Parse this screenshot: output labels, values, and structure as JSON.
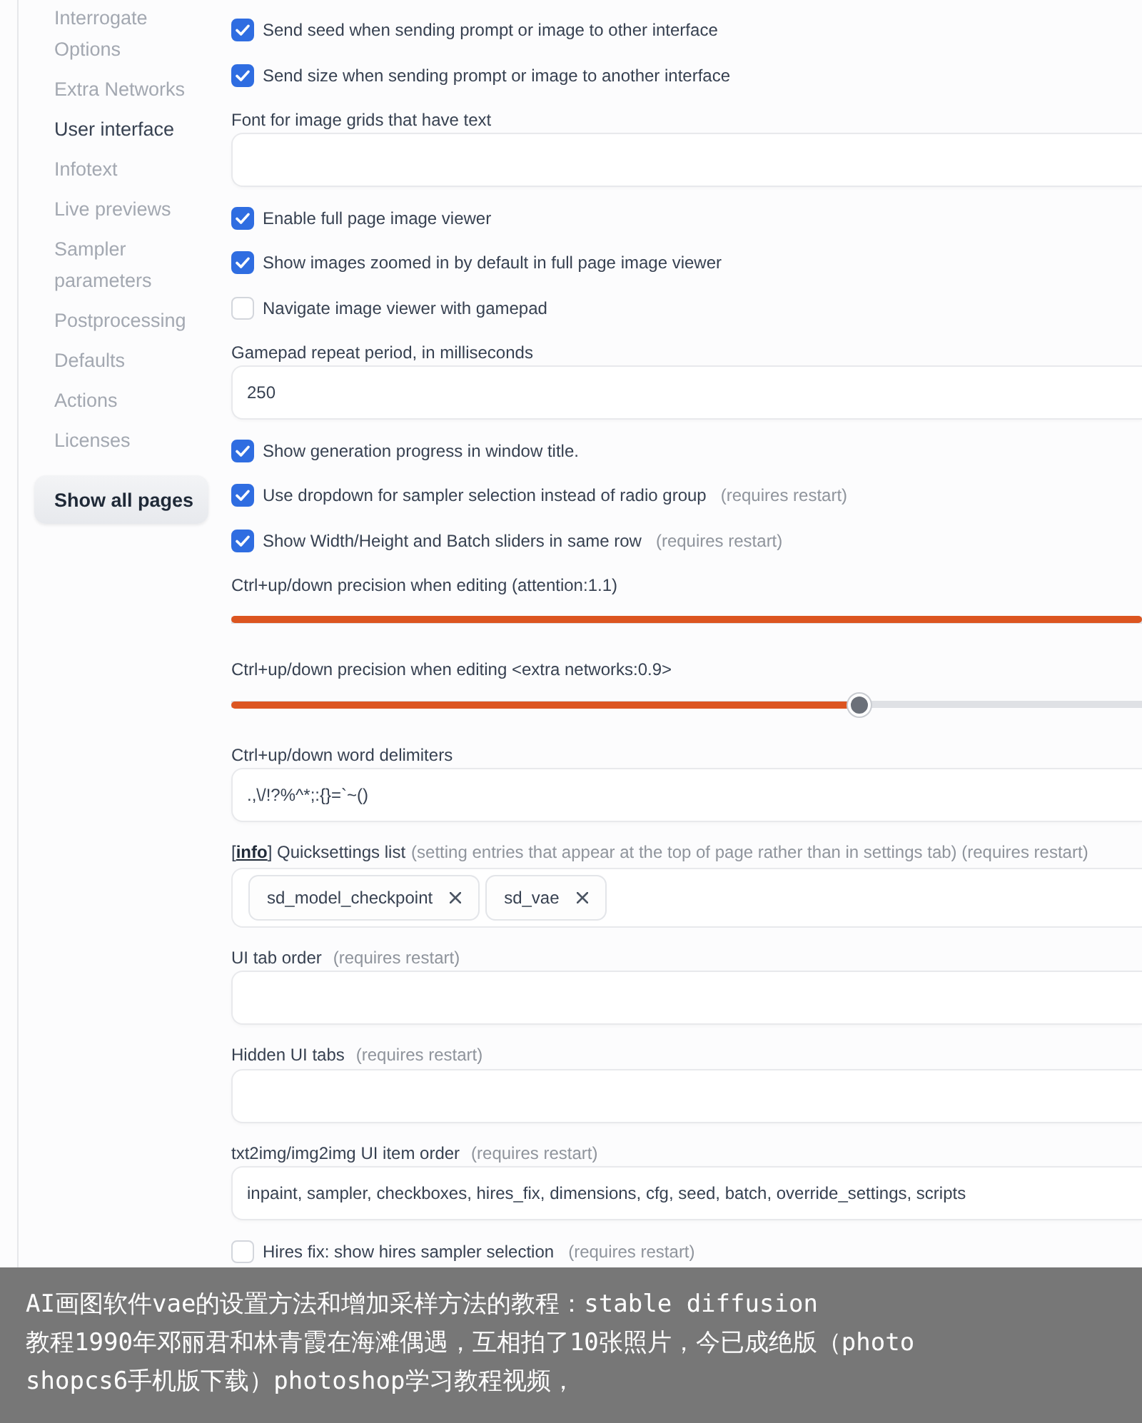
{
  "sidebar": {
    "items": [
      {
        "label": "Interrogate Options",
        "selected": false
      },
      {
        "label": "Extra Networks",
        "selected": false
      },
      {
        "label": "User interface",
        "selected": true
      },
      {
        "label": "Infotext",
        "selected": false
      },
      {
        "label": "Live previews",
        "selected": false
      },
      {
        "label": "Sampler parameters",
        "selected": false
      },
      {
        "label": "Postprocessing",
        "selected": false
      },
      {
        "label": "Defaults",
        "selected": false
      },
      {
        "label": "Actions",
        "selected": false
      },
      {
        "label": "Licenses",
        "selected": false
      }
    ],
    "show_all_button": "Show all pages"
  },
  "settings": [
    {
      "kind": "checkbox",
      "label": "Send seed when sending prompt or image to other interface",
      "checked": true
    },
    {
      "kind": "checkbox",
      "label": "Send size when sending prompt or image to another interface",
      "checked": true
    },
    {
      "kind": "text",
      "label": "Font for image grids that have text"
    },
    {
      "kind": "checkbox",
      "label": "Enable full page image viewer",
      "checked": true
    },
    {
      "kind": "checkbox",
      "label": "Show images zoomed in by default in full page image viewer",
      "checked": true
    },
    {
      "kind": "checkbox",
      "label": "Navigate image viewer with gamepad",
      "checked": false
    },
    {
      "kind": "text",
      "label": "Gamepad repeat period, in milliseconds",
      "value": "250"
    },
    {
      "kind": "checkbox",
      "label": "Show generation progress in window title.",
      "checked": true
    },
    {
      "kind": "checkbox",
      "label": "Use dropdown for sampler selection instead of radio group",
      "hint": "(requires restart)",
      "checked": true
    },
    {
      "kind": "checkbox",
      "label": "Show Width/Height and Batch sliders in same row",
      "hint": "(requires restart)",
      "checked": true
    },
    {
      "kind": "slider",
      "label": "Ctrl+up/down precision when editing (attention:1.1)",
      "level": 1
    },
    {
      "kind": "slider",
      "label": "Ctrl+up/down precision when editing <extra networks:0.9>",
      "level": 0.69
    },
    {
      "kind": "text",
      "label": "Ctrl+up/down word delimiters",
      "value": ".,\\/!?%^*;:{}=`~()"
    },
    {
      "kind": "tags",
      "label_parts": [
        {
          "kind": "text",
          "text": "["
        },
        {
          "kind": "link",
          "text": "info"
        },
        {
          "kind": "text",
          "text": "] Quicksettings list"
        }
      ],
      "hint": "(setting entries that appear at the top of page rather than in settings tab) (requires restart)",
      "tags": [
        "sd_model_checkpoint",
        "sd_vae"
      ]
    },
    {
      "kind": "text",
      "label": "UI tab order",
      "hint": "(requires restart)"
    },
    {
      "kind": "text",
      "label": "Hidden UI tabs",
      "hint": "(requires restart)"
    },
    {
      "kind": "text",
      "label": "txt2img/img2img UI item order",
      "hint": "(requires restart)",
      "value": "inpaint, sampler, checkboxes, hires_fix, dimensions, cfg, seed, batch, override_settings, scripts"
    },
    {
      "kind": "checkbox",
      "label": "Hires fix: show hires sampler selection",
      "hint": "(requires restart)",
      "checked": false
    }
  ],
  "caption": {
    "lines": [
      "AI画图软件vae的设置方法和增加采样方法的教程：stable diffusion",
      "教程1990年邓丽君和林青霞在海滩偶遇，互相拍了10张照片，今已成绝版（photo",
      "shopcs6手机版下载）photoshop学习教程视频，"
    ]
  }
}
